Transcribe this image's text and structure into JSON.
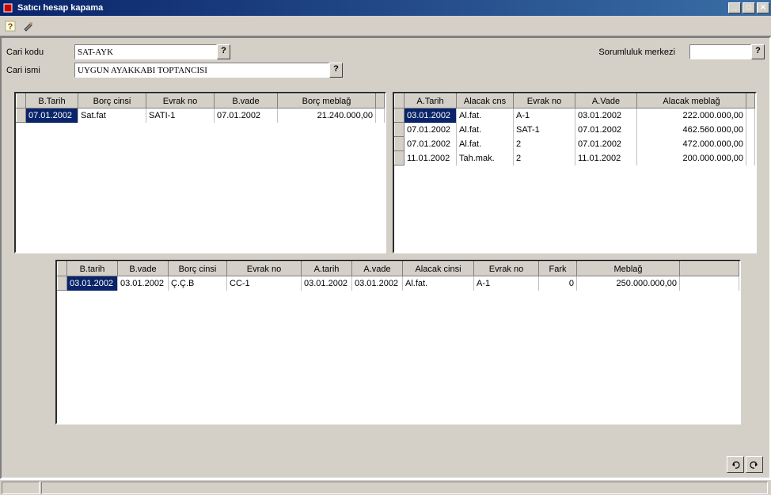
{
  "window": {
    "title": "Satıcı hesap kapama"
  },
  "form": {
    "cari_kodu_label": "Cari kodu",
    "cari_kodu_value": "SAT-AYK",
    "cari_ismi_label": "Cari ismi",
    "cari_ismi_value": "UYGUN AYAKKABI TOPTANCISI",
    "sorumluluk_label": "Sorumluluk merkezi",
    "sorumluluk_value": ""
  },
  "borc_table": {
    "headers": [
      "B.Tarih",
      "Borç cinsi",
      "Evrak no",
      "B.vade",
      "Borç meblağ"
    ],
    "rows": [
      {
        "tarih": "07.01.2002",
        "cins": "Sat.fat",
        "evrak": "SATI-1",
        "vade": "07.01.2002",
        "meblag": "21.240.000,00",
        "selected": true
      }
    ]
  },
  "alacak_table": {
    "headers": [
      "A.Tarih",
      "Alacak cns",
      "Evrak no",
      "A.Vade",
      "Alacak meblağ"
    ],
    "rows": [
      {
        "tarih": "03.01.2002",
        "cins": "Al.fat.",
        "evrak": "A-1",
        "vade": "03.01.2002",
        "meblag": "222.000.000,00"
      },
      {
        "tarih": "07.01.2002",
        "cins": "Al.fat.",
        "evrak": "SAT-1",
        "vade": "07.01.2002",
        "meblag": "462.560.000,00"
      },
      {
        "tarih": "07.01.2002",
        "cins": "Al.fat.",
        "evrak": "2",
        "vade": "07.01.2002",
        "meblag": "472.000.000,00"
      },
      {
        "tarih": "11.01.2002",
        "cins": "Tah.mak.",
        "evrak": "2",
        "vade": "11.01.2002",
        "meblag": "200.000.000,00"
      }
    ]
  },
  "match_table": {
    "headers": [
      "B.tarih",
      "B.vade",
      "Borç cinsi",
      "Evrak no",
      "A.tarih",
      "A.vade",
      "Alacak cinsi",
      "Evrak no",
      "Fark",
      "Meblağ"
    ],
    "rows": [
      {
        "btarih": "03.01.2002",
        "bvade": "03.01.2002",
        "bcins": "Ç.Ç.B",
        "bevrak": "CC-1",
        "atarih": "03.01.2002",
        "avade": "03.01.2002",
        "acins": "Al.fat.",
        "aevrak": "A-1",
        "fark": "0",
        "meblag": "250.000.000,00",
        "selected": true
      }
    ]
  }
}
